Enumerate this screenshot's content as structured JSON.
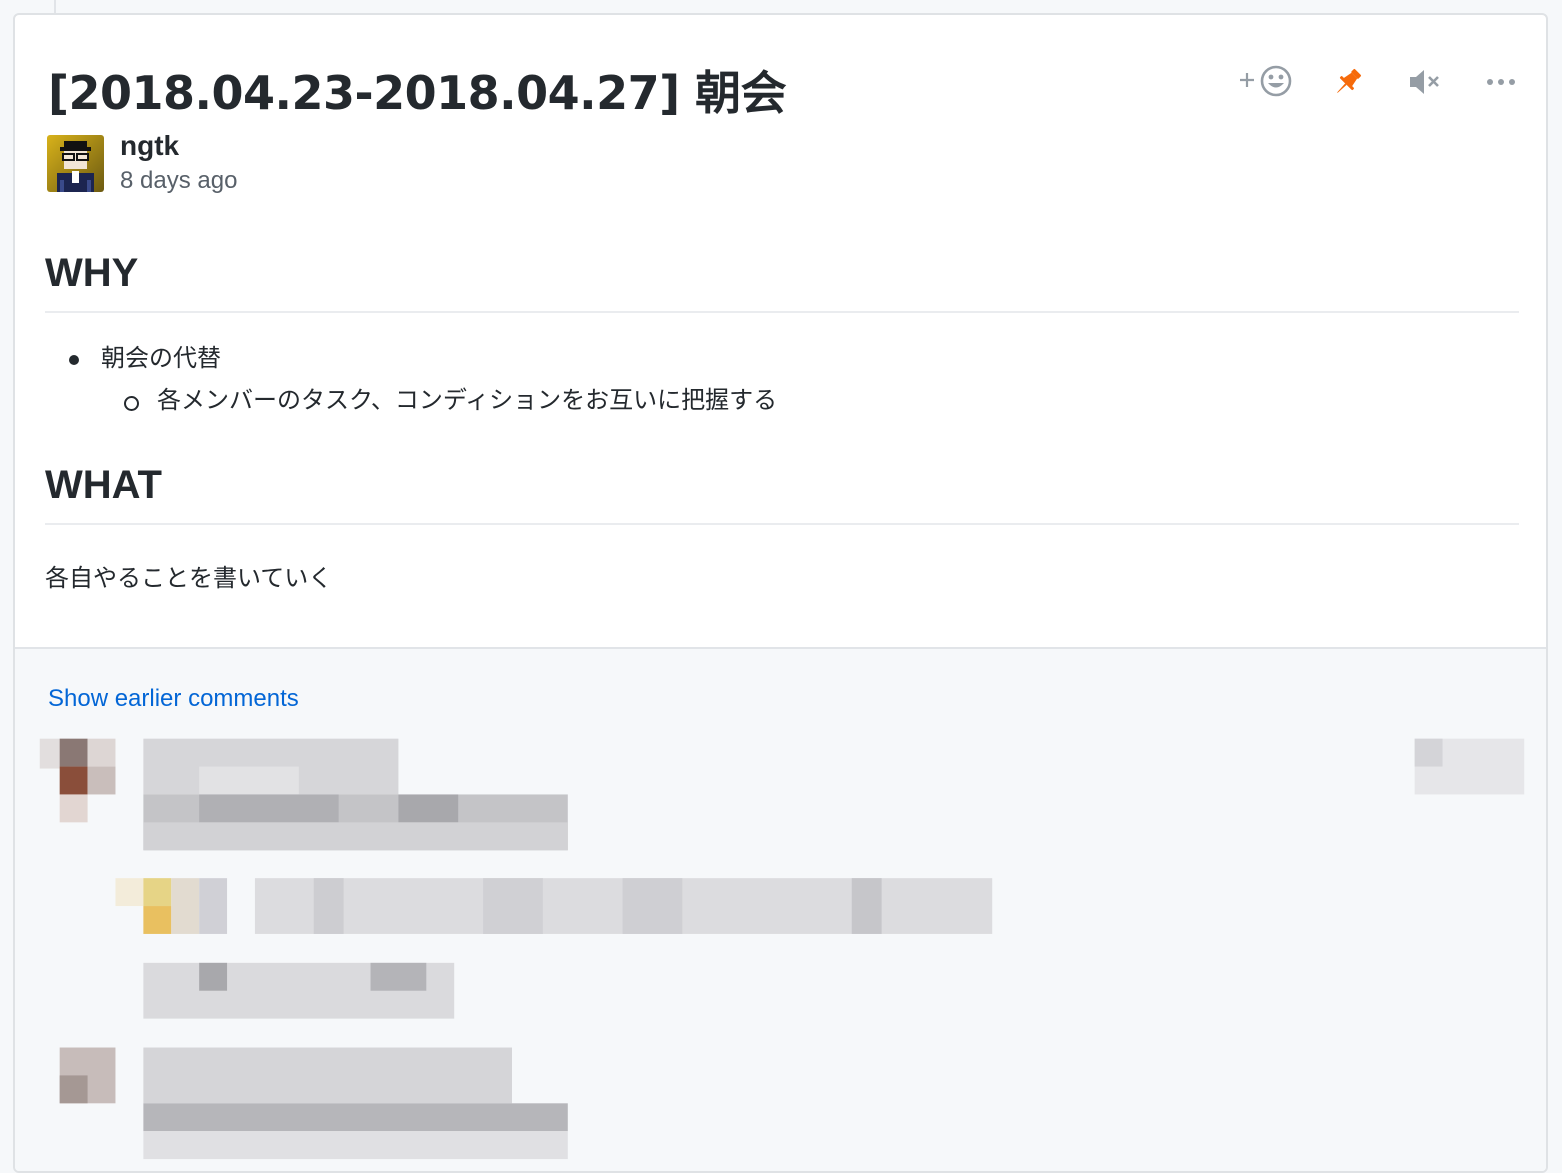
{
  "issue": {
    "title": "[2018.04.23-2018.04.27] 朝会",
    "author": {
      "name": "ngtk",
      "time": "8 days ago"
    }
  },
  "actions": {
    "emoji_icon": "add-reaction-icon",
    "pin_icon": "pin-icon",
    "mute_icon": "mute-icon",
    "more_icon": "more-icon",
    "pin_color": "#f66a0a",
    "icon_color": "#959da5"
  },
  "content": {
    "why_heading": "WHY",
    "why_item": "朝会の代替",
    "why_subitem": "各メンバーのタスク、コンディションをお互いに把握する",
    "what_heading": "WHAT",
    "what_text": "各自やることを書いていく"
  },
  "comments": {
    "show_earlier": "Show earlier comments"
  },
  "colors": {
    "link": "#0366d6",
    "text": "#24292e",
    "muted": "#586069"
  }
}
